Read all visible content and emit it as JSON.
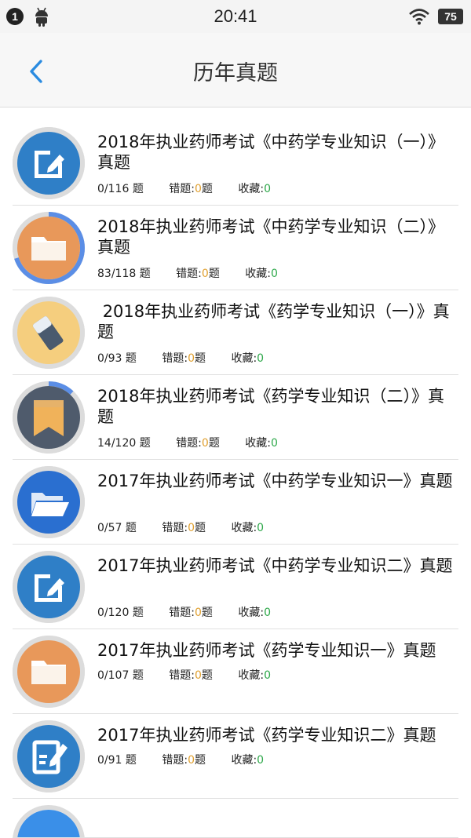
{
  "status_bar": {
    "notification_count": "1",
    "time": "20:41",
    "battery": "75"
  },
  "nav": {
    "title": "历年真题",
    "back_icon": "chevron-left-icon"
  },
  "labels": {
    "unit": "题",
    "wrong": "错题:",
    "wrong_unit": "题",
    "fav": "收藏:"
  },
  "colors": {
    "accent_blue": "#2a7fcf",
    "wrong_count": "#e0a030",
    "fav_count": "#2ea84a"
  },
  "items": [
    {
      "title": "2018年执业药师考试《中药学专业知识（一）》真题",
      "progress": "0/116",
      "wrong": "0",
      "fav": "0",
      "icon": "edit-icon",
      "completion": 0.0
    },
    {
      "title": "2018年执业药师考试《中药学专业知识（二）》真题",
      "progress": "83/118",
      "wrong": "0",
      "fav": "0",
      "icon": "folder-icon",
      "completion": 0.7
    },
    {
      "title": " 2018年执业药师考试《药学专业知识（一）》真题",
      "progress": "0/93",
      "wrong": "0",
      "fav": "0",
      "icon": "eraser-icon",
      "completion": 0.0
    },
    {
      "title": "2018年执业药师考试《药学专业知识（二）》真题",
      "progress": "14/120",
      "wrong": "0",
      "fav": "0",
      "icon": "bookmark-icon",
      "completion": 0.12
    },
    {
      "title": "2017年执业药师考试《中药学专业知识一》真题",
      "progress": "0/57",
      "wrong": "0",
      "fav": "0",
      "icon": "open-folder-icon",
      "completion": 0.0
    },
    {
      "title": "2017年执业药师考试《中药学专业知识二》真题",
      "progress": "0/120",
      "wrong": "0",
      "fav": "0",
      "icon": "edit-icon",
      "completion": 0.0
    },
    {
      "title": "2017年执业药师考试《药学专业知识一》真题",
      "progress": "0/107",
      "wrong": "0",
      "fav": "0",
      "icon": "folder-icon",
      "completion": 0.0
    },
    {
      "title": "2017年执业药师考试《药学专业知识二》真题",
      "progress": "0/91",
      "wrong": "0",
      "fav": "0",
      "icon": "note-pen-icon",
      "completion": 0.0
    }
  ]
}
